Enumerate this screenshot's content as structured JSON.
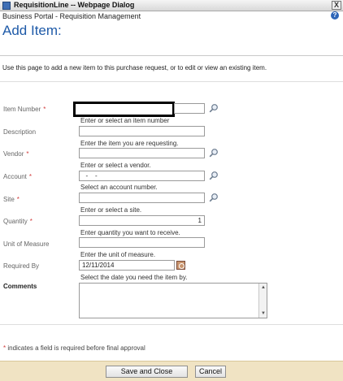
{
  "window": {
    "title": "RequisitionLine -- Webpage Dialog",
    "close_label": "X"
  },
  "header": {
    "breadcrumb": "Business Portal - Requisition Management",
    "page_title": "Add Item:",
    "help_label": "?"
  },
  "intro": "Use this page to add a new item to this purchase request, or to edit or view an existing item.",
  "fields": {
    "item_number": {
      "label": "Item Number",
      "required": "*",
      "value": "",
      "hint": "Enter or select an item number"
    },
    "description": {
      "label": "Description",
      "value": "",
      "hint": "Enter the item you are requesting."
    },
    "vendor": {
      "label": "Vendor",
      "required": "*",
      "value": "",
      "hint": "Enter or select a vendor."
    },
    "account": {
      "label": "Account",
      "required": "*",
      "value": "  -    -",
      "hint": "Select an account number."
    },
    "site": {
      "label": "Site",
      "required": "*",
      "value": "",
      "hint": "Enter or select a site."
    },
    "quantity": {
      "label": "Quantity",
      "required": "*",
      "value": "1",
      "hint": "Enter quantity you want to receive."
    },
    "unit_of_measure": {
      "label": "Unit of Measure",
      "value": "",
      "hint": "Enter the unit of measure."
    },
    "required_by": {
      "label": "Required By",
      "value": "12/11/2014",
      "hint": "Select the date you need the item by."
    },
    "comments": {
      "label": "Comments",
      "value": ""
    }
  },
  "footnote": {
    "star": "*",
    "text": " indicates a field is required before final approval"
  },
  "buttons": {
    "save_close": "Save and Close",
    "cancel": "Cancel"
  }
}
